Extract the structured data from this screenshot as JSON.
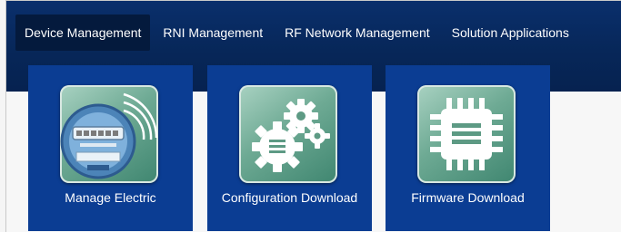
{
  "nav": {
    "items": [
      {
        "label": "Device Management",
        "active": true
      },
      {
        "label": "RNI Management"
      },
      {
        "label": "RF Network Management"
      },
      {
        "label": "Solution Applications"
      }
    ]
  },
  "tiles": [
    {
      "label": "Manage Electric",
      "icon": "electric-meter-icon"
    },
    {
      "label": "Configuration Download",
      "icon": "gears-icon"
    },
    {
      "label": "Firmware Download",
      "icon": "chip-icon"
    }
  ],
  "colors": {
    "topbar": "#072759",
    "tile": "#0b3d93",
    "icon_green": "#6eaa94",
    "active_nav": "#041a3d"
  }
}
